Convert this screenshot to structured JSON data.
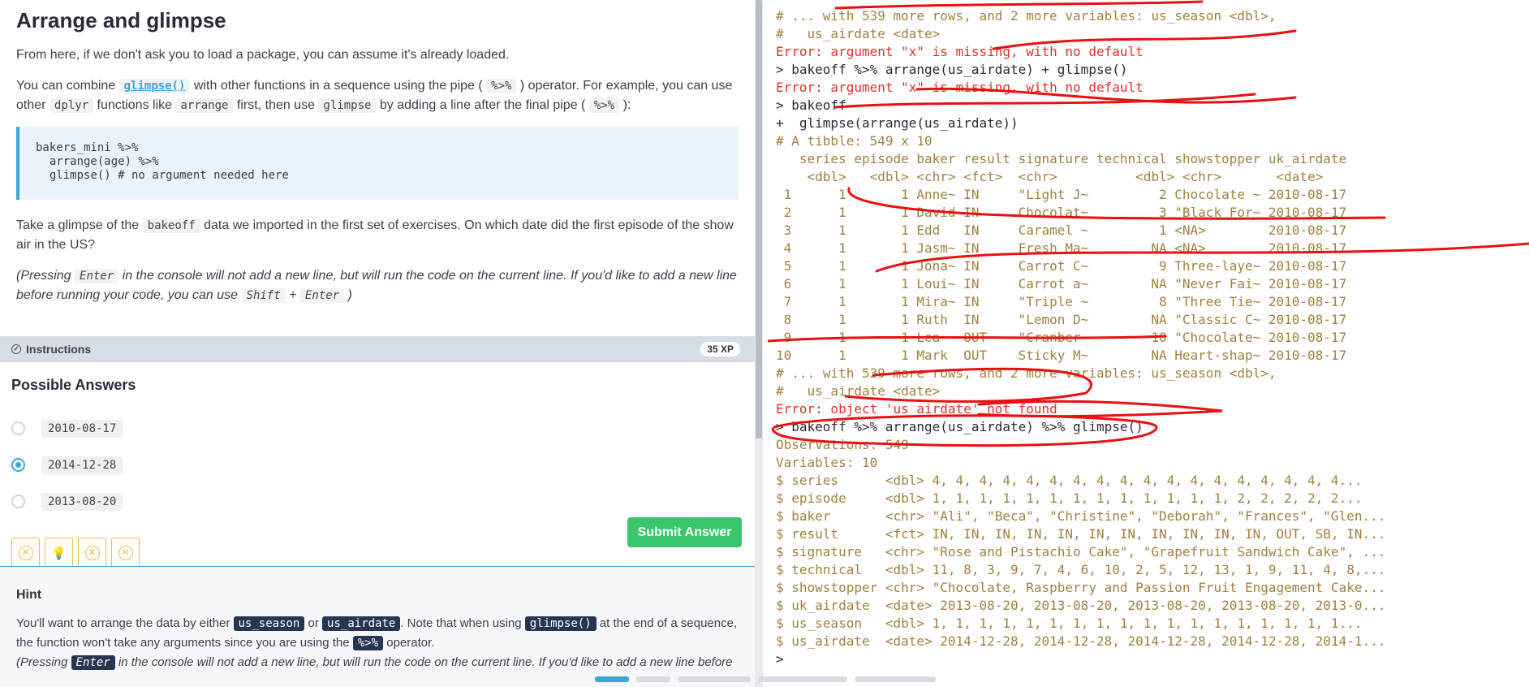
{
  "exercise": {
    "title": "Arrange and glimpse",
    "intro": "From here, if we don't ask you to load a package, you can assume it's already loaded.",
    "para2": {
      "t1": "You can combine ",
      "c1": "glimpse()",
      "t2": " with other functions in a sequence using the pipe ( ",
      "c2": "%>%",
      "t3": " ) operator. For example, you can use other ",
      "c3": "dplyr",
      "t4": " functions like ",
      "c4": "arrange",
      "t5": " first, then use ",
      "c5": "glimpse",
      "t6": " by adding a line after the final pipe ( ",
      "c6": "%>%",
      "t7": " ):"
    },
    "code_example": "bakers_mini %>%\n  arrange(age) %>%\n  glimpse() # no argument needed here",
    "question": {
      "t1": "Take a glimpse of the ",
      "c1": "bakeoff",
      "t2": " data we imported in the first set of exercises. On which date did the first episode of the show air in the US?"
    },
    "note": {
      "t1": "(Pressing ",
      "c1": "Enter",
      "t2": " in the console will not add a new line, but will run the code on the current line. If you'd like to add a new line before running your code, you can use ",
      "c2": "Shift",
      "t3": " + ",
      "c3": "Enter",
      "t4": " )"
    }
  },
  "instructions": {
    "label": "Instructions",
    "xp": "35 XP"
  },
  "answers": {
    "heading": "Possible Answers",
    "options": [
      "2010-08-17",
      "2014-12-28",
      "2013-08-20"
    ],
    "selected": "2014-12-28"
  },
  "submit_label": "Submit Answer",
  "hint": {
    "title": "Hint",
    "t1": "You'll want to arrange the data by either ",
    "c1": "us_season",
    "t2": " or ",
    "c2": "us_airdate",
    "t3": ". Note that when using ",
    "c3": "glimpse()",
    "t4": " at the end of a sequence, the function won't take any arguments since you are using the ",
    "c4": "%>%",
    "t5": " operator.",
    "n1": "(Pressing ",
    "nc1": "Enter",
    "n2": " in the console will not add a new line, but will run the code on the current line. If you'd like to add a new line before"
  },
  "console_lines": [
    {
      "cls": "c-com",
      "text": "# ... with 539 more rows, and 2 more variables: us_season <dbl>,"
    },
    {
      "cls": "c-com",
      "text": "#   us_airdate <date>"
    },
    {
      "cls": "c-err",
      "text": "Error: argument \"x\" is missing, with no default"
    },
    {
      "cls": "c-cmd",
      "text": "> bakeoff %>% arrange(us_airdate) + glimpse()"
    },
    {
      "cls": "c-err",
      "text": "Error: argument \"x\" is missing, with no default"
    },
    {
      "cls": "c-cmd",
      "text": "> bakeoff"
    },
    {
      "cls": "c-cmd",
      "text": "+  glimpse(arrange(us_airdate))"
    },
    {
      "cls": "c-out",
      "text": "# A tibble: 549 x 10"
    },
    {
      "cls": "c-out",
      "text": "   series episode baker result signature technical showstopper uk_airdate"
    },
    {
      "cls": "c-out",
      "text": "    <dbl>   <dbl> <chr> <fct>  <chr>          <dbl> <chr>       <date>"
    },
    {
      "cls": "c-out",
      "text": " 1      1       1 Anne~ IN     \"Light J~         2 Chocolate ~ 2010-08-17"
    },
    {
      "cls": "c-out",
      "text": " 2      1       1 David IN     Chocolat~         3 \"Black For~ 2010-08-17"
    },
    {
      "cls": "c-out",
      "text": " 3      1       1 Edd   IN     Caramel ~         1 <NA>        2010-08-17"
    },
    {
      "cls": "c-out",
      "text": " 4      1       1 Jasm~ IN     Fresh Ma~        NA <NA>        2010-08-17"
    },
    {
      "cls": "c-out",
      "text": " 5      1       1 Jona~ IN     Carrot C~         9 Three-laye~ 2010-08-17"
    },
    {
      "cls": "c-out",
      "text": " 6      1       1 Loui~ IN     Carrot a~        NA \"Never Fai~ 2010-08-17"
    },
    {
      "cls": "c-out",
      "text": " 7      1       1 Mira~ IN     \"Triple ~         8 \"Three Tie~ 2010-08-17"
    },
    {
      "cls": "c-out",
      "text": " 8      1       1 Ruth  IN     \"Lemon D~        NA \"Classic C~ 2010-08-17"
    },
    {
      "cls": "c-out",
      "text": " 9      1       1 Lea   OUT    \"Cranber~        10 \"Chocolate~ 2010-08-17"
    },
    {
      "cls": "c-out",
      "text": "10      1       1 Mark  OUT    Sticky M~        NA Heart-shap~ 2010-08-17"
    },
    {
      "cls": "c-com",
      "text": "# ... with 539 more rows, and 2 more variables: us_season <dbl>,"
    },
    {
      "cls": "c-com",
      "text": "#   us_airdate <date>"
    },
    {
      "cls": "c-err",
      "text": "Error: object 'us_airdate' not found"
    },
    {
      "cls": "c-cmd",
      "text": "> bakeoff %>% arrange(us_airdate) %>% glimpse()"
    },
    {
      "cls": "c-out",
      "text": "Observations: 549"
    },
    {
      "cls": "c-out",
      "text": "Variables: 10"
    },
    {
      "cls": "c-out",
      "text": "$ series      <dbl> 4, 4, 4, 4, 4, 4, 4, 4, 4, 4, 4, 4, 4, 4, 4, 4, 4, 4..."
    },
    {
      "cls": "c-out",
      "text": "$ episode     <dbl> 1, 1, 1, 1, 1, 1, 1, 1, 1, 1, 1, 1, 1, 2, 2, 2, 2, 2..."
    },
    {
      "cls": "c-out",
      "text": "$ baker       <chr> \"Ali\", \"Beca\", \"Christine\", \"Deborah\", \"Frances\", \"Glen..."
    },
    {
      "cls": "c-out",
      "text": "$ result      <fct> IN, IN, IN, IN, IN, IN, IN, IN, IN, IN, IN, OUT, SB, IN..."
    },
    {
      "cls": "c-out",
      "text": "$ signature   <chr> \"Rose and Pistachio Cake\", \"Grapefruit Sandwich Cake\", ..."
    },
    {
      "cls": "c-out",
      "text": "$ technical   <dbl> 11, 8, 3, 9, 7, 4, 6, 10, 2, 5, 12, 13, 1, 9, 11, 4, 8,..."
    },
    {
      "cls": "c-out",
      "text": "$ showstopper <chr> \"Chocolate, Raspberry and Passion Fruit Engagement Cake..."
    },
    {
      "cls": "c-out",
      "text": "$ uk_airdate  <date> 2013-08-20, 2013-08-20, 2013-08-20, 2013-08-20, 2013-0..."
    },
    {
      "cls": "c-out",
      "text": "$ us_season   <dbl> 1, 1, 1, 1, 1, 1, 1, 1, 1, 1, 1, 1, 1, 1, 1, 1, 1, 1..."
    },
    {
      "cls": "c-out",
      "text": "$ us_airdate  <date> 2014-12-28, 2014-12-28, 2014-12-28, 2014-12-28, 2014-1..."
    },
    {
      "cls": "c-cmd",
      "text": "> "
    }
  ],
  "colors": {
    "accent": "#3aa6d6",
    "submit": "#3ac66c",
    "error": "#e0302a",
    "output": "#a18040",
    "annotation": "#e81010"
  }
}
